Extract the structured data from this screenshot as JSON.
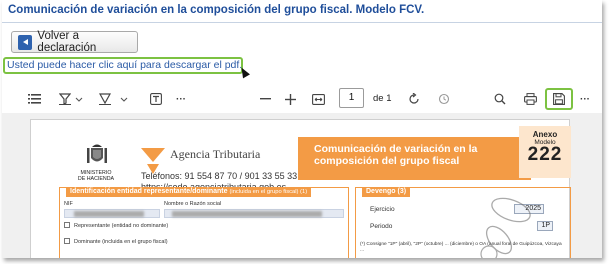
{
  "header": {
    "title": "Comunicación de variación en la composición del grupo fiscal. Modelo FCV."
  },
  "actions": {
    "back_label": "Volver a declaración"
  },
  "download": {
    "link_text": "Usted puede hacer clic aquí para descargar el pdf."
  },
  "pdf_toolbar": {
    "current_page": "1",
    "of_label": "de 1",
    "icons": [
      "list-icon",
      "highlight-icon",
      "chevron-down-icon",
      "draw-icon",
      "chevron-down-icon",
      "text-box-icon",
      "more-icon",
      "zoom-out-icon",
      "zoom-in-icon",
      "fit-page-icon",
      "rotate-icon",
      "history-icon",
      "search-icon",
      "print-icon",
      "save-icon",
      "more-icon"
    ]
  },
  "document": {
    "ministerio": "MINISTERIO\nDE HACIENDA",
    "agency_name": "Agencia Tributaria",
    "phone": "Teléfonos: 91 554 87 70 / 901 33 55 33",
    "web": "https://sede.agenciatributaria.gob.es",
    "form_title": "Comunicación de variación en la composición del grupo fiscal",
    "anexo_label": "Anexo",
    "modelo_label": "Modelo",
    "modelo_number": "222",
    "section1": {
      "title": "Identificación entidad representante/dominante",
      "subtitle": "(incluida en el grupo fiscal) (1)",
      "nif_label": "NIF",
      "name_label": "Nombre o Razón social",
      "representante_label": "Representante (entidad no dominante)",
      "dominante_label": "Dominante (incluida en el grupo fiscal)"
    },
    "section2": {
      "title": "Devengo (3)",
      "ejercicio_label": "Ejercicio",
      "ejercicio_value": "2025",
      "periodo_label": "Periodo",
      "periodo_value": "1P",
      "note": "(*) Consigne \"1P\" (abril), \"2P\" (octubre) ... (diciembre) o OA (anual foral de Guipúzcoa, Vizcaya ..."
    }
  },
  "colors": {
    "accent_orange": "#f39b45",
    "highlight_green": "#7cc242",
    "link_blue": "#2b5ba6"
  }
}
